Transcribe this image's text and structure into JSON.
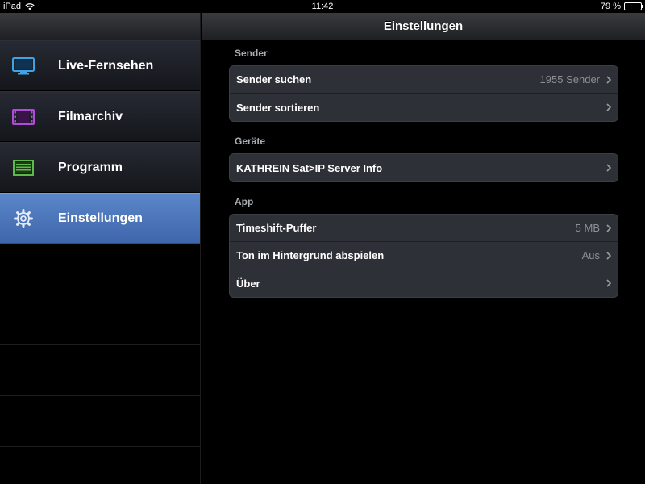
{
  "status_bar": {
    "device": "iPad",
    "time": "11:42",
    "battery": "79 %",
    "battery_level": 0.79
  },
  "sidebar": {
    "items": [
      {
        "label": "Live-Fernsehen",
        "icon": "tv-icon",
        "active": false
      },
      {
        "label": "Filmarchiv",
        "icon": "film-icon",
        "active": false
      },
      {
        "label": "Programm",
        "icon": "program-guide-icon",
        "active": false
      },
      {
        "label": "Einstellungen",
        "icon": "gear-icon",
        "active": true
      }
    ]
  },
  "main": {
    "title": "Einstellungen",
    "sections": [
      {
        "title": "Sender",
        "rows": [
          {
            "label": "Sender suchen",
            "value": "1955 Sender"
          },
          {
            "label": "Sender sortieren",
            "value": ""
          }
        ]
      },
      {
        "title": "Geräte",
        "rows": [
          {
            "label": "KATHREIN Sat>IP Server Info",
            "value": ""
          }
        ]
      },
      {
        "title": "App",
        "rows": [
          {
            "label": "Timeshift-Puffer",
            "value": "5 MB"
          },
          {
            "label": "Ton im Hintergrund abspielen",
            "value": "Aus"
          },
          {
            "label": "Über",
            "value": ""
          }
        ]
      }
    ]
  },
  "colors": {
    "active_accent": "#4a74bb",
    "tv_icon": "#3fa3e8",
    "film_icon": "#b04ad8",
    "program_icon": "#5fb84a"
  }
}
